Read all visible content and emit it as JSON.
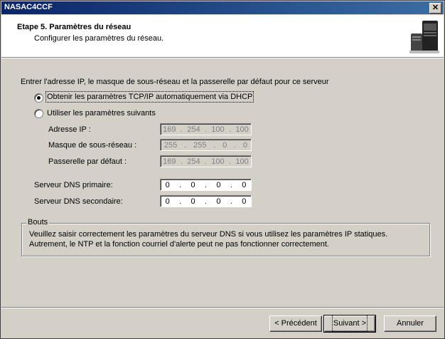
{
  "window": {
    "title": "NASAC4CCF",
    "close_glyph": "✕"
  },
  "header": {
    "title": "Etape 5. Paramètres du réseau",
    "subtitle": "Configurer les paramètres du réseau."
  },
  "intro": "Entrer l'adresse IP, le masque de sous-réseau et la passerelle par défaut pour ce serveur",
  "options": {
    "dhcp": {
      "label": "Obtenir les paramètres TCP/IP automatiquement via DHCP",
      "selected": true
    },
    "manual": {
      "label": "Utiliser les paramètres suivants",
      "selected": false
    }
  },
  "fields": {
    "ip": {
      "label": "Adresse IP :",
      "octets": [
        "169",
        "254",
        "100",
        "100"
      ],
      "enabled": false
    },
    "mask": {
      "label": "Masque de sous-réseau :",
      "octets": [
        "255",
        "255",
        "0",
        "0"
      ],
      "enabled": false
    },
    "gateway": {
      "label": "Passerelle par défaut :",
      "octets": [
        "169",
        "254",
        "100",
        "100"
      ],
      "enabled": false
    },
    "dns1": {
      "label": "Serveur DNS primaire:",
      "octets": [
        "0",
        "0",
        "0",
        "0"
      ],
      "enabled": true
    },
    "dns2": {
      "label": "Serveur DNS secondaire:",
      "octets": [
        "0",
        "0",
        "0",
        "0"
      ],
      "enabled": true
    }
  },
  "tips": {
    "legend": "Bouts",
    "text": "Veuillez saisir correctement les paramètres du serveur DNS si vous utilisez les paramètres IP statiques.  Autrement, le NTP et la fonction courriel d'alerte peut ne pas fonctionner correctement."
  },
  "buttons": {
    "back": "< Précédent",
    "next": "Suivant >",
    "cancel": "Annuler"
  }
}
